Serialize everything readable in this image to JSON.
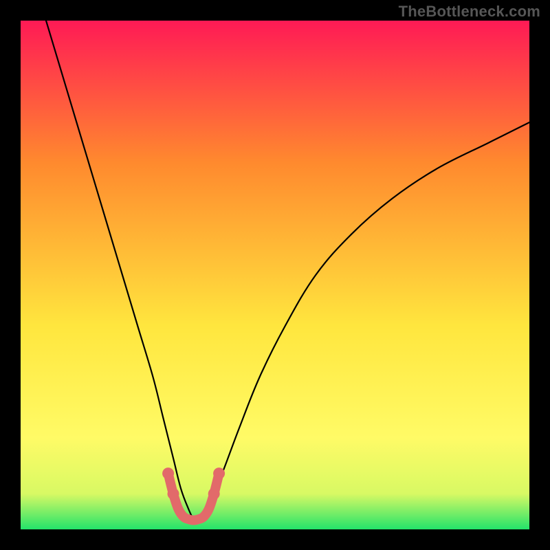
{
  "watermark": {
    "text": "TheBottleneck.com"
  },
  "chart_data": {
    "type": "line",
    "title": "",
    "xlabel": "",
    "ylabel": "",
    "xlim": [
      0,
      100
    ],
    "ylim": [
      0,
      100
    ],
    "background_gradient": {
      "top_color": "#ff1a55",
      "mid1_color": "#ff8a2e",
      "mid2_color": "#ffe63e",
      "mid3_color": "#fffb66",
      "mid4_color": "#d8f964",
      "bottom_color": "#23e36a"
    },
    "series": [
      {
        "name": "bottleneck-curve",
        "color": "#000000",
        "x": [
          5,
          8,
          11,
          14,
          17,
          20,
          23,
          26,
          28,
          30,
          31.5,
          33,
          34,
          35,
          36,
          37,
          38,
          40,
          43,
          47,
          52,
          58,
          65,
          73,
          82,
          92,
          100
        ],
        "y": [
          100,
          90,
          80,
          70,
          60,
          50,
          40,
          30,
          22,
          14,
          8,
          4,
          2,
          1.5,
          2,
          4,
          7,
          12,
          20,
          30,
          40,
          50,
          58,
          65,
          71,
          76,
          80
        ]
      },
      {
        "name": "highlight-band",
        "color": "#e26a6a",
        "x": [
          29,
          30,
          31,
          32,
          33,
          34,
          35,
          36,
          37,
          38,
          39
        ],
        "y": [
          11,
          7,
          4,
          2.5,
          2,
          1.8,
          2,
          2.5,
          4,
          7,
          11
        ]
      }
    ]
  }
}
